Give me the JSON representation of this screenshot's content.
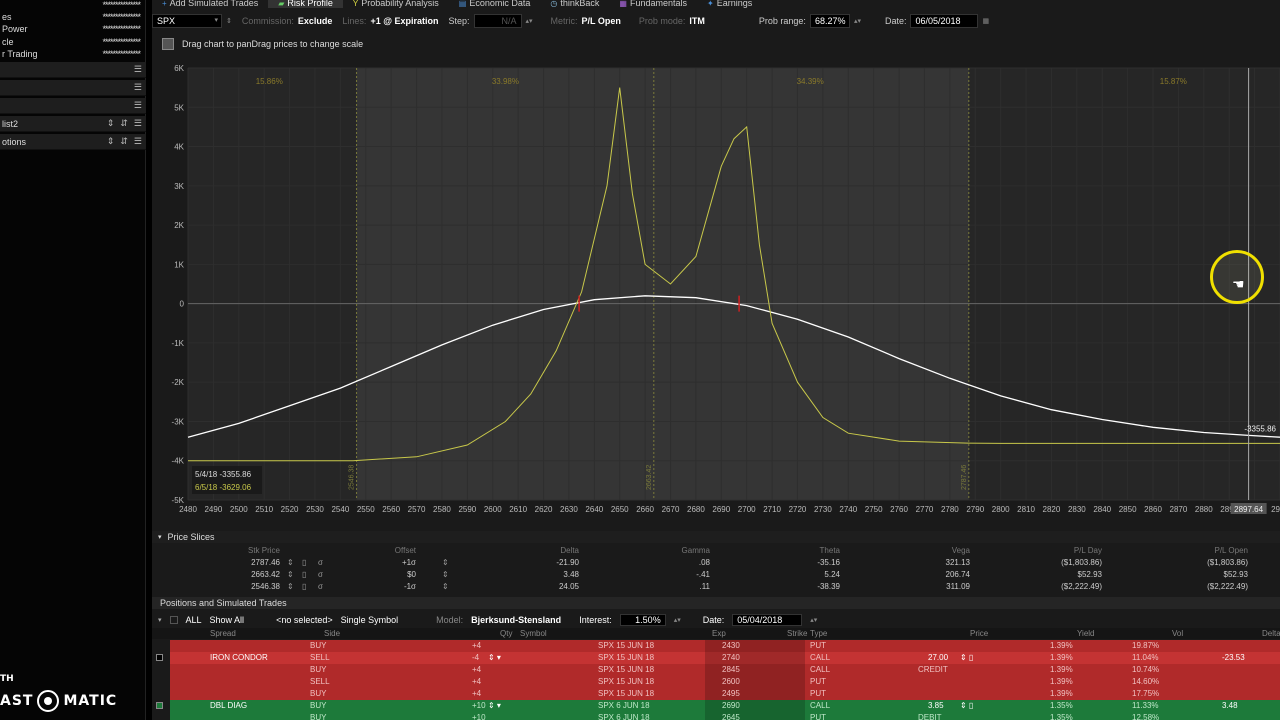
{
  "sidebar": {
    "rows": [
      {
        "label": "",
        "value": "***************"
      },
      {
        "label": "es",
        "value": "***************"
      },
      {
        "label": "Power",
        "value": "***************"
      },
      {
        "label": "cle",
        "value": "***************"
      },
      {
        "label": "r Trading",
        "value": "***************"
      }
    ],
    "panels": [
      {
        "label": ""
      },
      {
        "label": ""
      },
      {
        "label": ""
      },
      {
        "label": ""
      },
      {
        "label": "list2"
      },
      {
        "label": "otions"
      }
    ],
    "watermark_top": "TH",
    "watermark_left": "AST",
    "watermark_right": "MATIC"
  },
  "tabs": [
    {
      "label": "Add Simulated Trades",
      "icon": "plus-icon"
    },
    {
      "label": "Risk Profile",
      "icon": "risk-profile-icon",
      "active": true
    },
    {
      "label": "Probability Analysis",
      "icon": "probability-icon"
    },
    {
      "label": "Economic Data",
      "icon": "economic-data-icon"
    },
    {
      "label": "thinkBack",
      "icon": "thinkback-icon"
    },
    {
      "label": "Fundamentals",
      "icon": "fundamentals-icon"
    },
    {
      "label": "Earnings",
      "icon": "earnings-icon"
    }
  ],
  "controls": {
    "symbol": "SPX",
    "commission_label": "Commission:",
    "commission_value": "Exclude",
    "lines_label": "Lines:",
    "lines_value": "+1 @ Expiration",
    "step_label": "Step:",
    "step_value": "N/A",
    "metric_label": "Metric:",
    "metric_value": "P/L Open",
    "prob_mode_label": "Prob mode:",
    "prob_mode_value": "ITM",
    "prob_range_label": "Prob range:",
    "prob_range_value": "68.27%",
    "date_label": "Date:",
    "date_value": "06/05/2018"
  },
  "chart_toolbar": {
    "hint": "Drag chart to panDrag prices to change scale"
  },
  "chart_data": {
    "type": "line",
    "xlim": [
      2480,
      2910
    ],
    "ylim": [
      -5000,
      6000
    ],
    "x_ticks": [
      2480,
      2490,
      2500,
      2510,
      2520,
      2530,
      2540,
      2550,
      2560,
      2570,
      2580,
      2590,
      2600,
      2610,
      2620,
      2630,
      2640,
      2650,
      2660,
      2670,
      2680,
      2690,
      2700,
      2710,
      2720,
      2730,
      2740,
      2750,
      2760,
      2770,
      2780,
      2790,
      2800,
      2810,
      2820,
      2830,
      2840,
      2850,
      2860,
      2870,
      2880,
      2890,
      2900,
      2910
    ],
    "y_ticks": [
      {
        "v": 6000,
        "label": "6K"
      },
      {
        "v": 5000,
        "label": "5K"
      },
      {
        "v": 4000,
        "label": "4K"
      },
      {
        "v": 3000,
        "label": "3K"
      },
      {
        "v": 2000,
        "label": "2K"
      },
      {
        "v": 1000,
        "label": "1K"
      },
      {
        "v": 0,
        "label": "0"
      },
      {
        "v": -1000,
        "label": "-1K"
      },
      {
        "v": -2000,
        "label": "-2K"
      },
      {
        "v": -3000,
        "label": "-3K"
      },
      {
        "v": -4000,
        "label": "-4K"
      },
      {
        "v": -5000,
        "label": "-5K"
      }
    ],
    "shaded_range": [
      2546.38,
      2787.46
    ],
    "center_price": 2663.42,
    "prob_labels": [
      {
        "x": 2512,
        "text": "15.86%"
      },
      {
        "x": 2605,
        "text": "33.98%"
      },
      {
        "x": 2725,
        "text": "34.39%"
      },
      {
        "x": 2868,
        "text": "15.87%"
      }
    ],
    "vline_labels": [
      {
        "x": 2546.38,
        "text": "2546.38"
      },
      {
        "x": 2663.42,
        "text": "2663.42"
      },
      {
        "x": 2787.46,
        "text": "2787.46"
      }
    ],
    "cursor_x_label": "2897.64",
    "cursor_y_label": "-3355.86",
    "legend": [
      {
        "text": "5/4/18  -3355.86",
        "color": "#dddddd"
      },
      {
        "text": "6/5/18  -3629.06",
        "color": "#c8c84a"
      }
    ],
    "series": [
      {
        "name": "5/4/18",
        "color": "#ffffff",
        "x": [
          2480,
          2500,
          2520,
          2540,
          2560,
          2580,
          2600,
          2620,
          2640,
          2660,
          2680,
          2700,
          2720,
          2740,
          2760,
          2780,
          2800,
          2820,
          2840,
          2860,
          2880,
          2897.64,
          2910
        ],
        "y": [
          -3400,
          -3050,
          -2600,
          -2150,
          -1600,
          -1050,
          -550,
          -150,
          100,
          200,
          150,
          -50,
          -400,
          -850,
          -1400,
          -1900,
          -2350,
          -2700,
          -2950,
          -3150,
          -3280,
          -3355.86,
          -3400
        ]
      },
      {
        "name": "6/5/18",
        "color": "#c8c84a",
        "x": [
          2480,
          2545,
          2570,
          2590,
          2605,
          2615,
          2625,
          2635,
          2645,
          2650,
          2655,
          2660,
          2670,
          2680,
          2690,
          2695,
          2700,
          2705,
          2710,
          2720,
          2730,
          2740,
          2760,
          2787,
          2800,
          2910
        ],
        "y": [
          -4000,
          -4000,
          -3900,
          -3600,
          -3000,
          -2300,
          -1200,
          300,
          3000,
          5500,
          2800,
          1000,
          500,
          1200,
          3500,
          4200,
          4500,
          1500,
          -500,
          -2000,
          -2900,
          -3300,
          -3500,
          -3550,
          -3560,
          -3560
        ]
      }
    ],
    "red_markers": [
      2634,
      2697
    ]
  },
  "slices": {
    "title": "Price Slices",
    "headers": [
      "Stk Price",
      "Offset",
      "Delta",
      "Gamma",
      "Theta",
      "Vega",
      "P/L Day",
      "P/L Open"
    ],
    "rows": [
      [
        "2787.46",
        "+1σ",
        "-21.90",
        ".08",
        "-35.16",
        "321.13",
        "($1,803.86)",
        "($1,803.86)"
      ],
      [
        "2663.42",
        "$0",
        "3.48",
        "-.41",
        "5.24",
        "206.74",
        "$52.93",
        "$52.93"
      ],
      [
        "2546.38",
        "-1σ",
        "24.05",
        ".11",
        "-38.39",
        "311.09",
        "($2,222.49)",
        "($2,222.49)"
      ]
    ]
  },
  "positions": {
    "title": "Positions and Simulated Trades",
    "all_label": "ALL",
    "show_all": "Show All",
    "selected": "<no selected>",
    "single_symbol": "Single Symbol",
    "model_label": "Model:",
    "model_value": "Bjerksund-Stensland",
    "interest_label": "Interest:",
    "interest_value": "1.50%",
    "date_label": "Date:",
    "date_value": "05/04/2018",
    "headers": [
      "Spread",
      "Side",
      "Qty",
      "Symbol",
      "Exp",
      "Strike",
      "Type",
      "Price",
      "Yield",
      "Vol",
      "Delta"
    ],
    "rows": [
      {
        "style": "red",
        "spread": "",
        "side": "BUY",
        "qty": "+4",
        "symbol": "SPX 15 JUN 18",
        "strike": "2430",
        "type": "PUT",
        "price": "",
        "price2": "",
        "yield": "1.39%",
        "vol": "19.87%",
        "delta": ""
      },
      {
        "style": "red2",
        "spread": "IRON CONDOR",
        "side": "SELL",
        "qty": "-4",
        "symbol": "SPX 15 JUN 18",
        "strike": "2740",
        "type": "CALL",
        "price": "27.00",
        "price2": "",
        "yield": "1.39%",
        "vol": "11.04%",
        "delta": "-23.53"
      },
      {
        "style": "red",
        "spread": "",
        "side": "BUY",
        "qty": "+4",
        "symbol": "SPX 15 JUN 18",
        "strike": "2845",
        "type": "CALL",
        "price": "",
        "price2": "CREDIT",
        "yield": "1.39%",
        "vol": "10.74%",
        "delta": ""
      },
      {
        "style": "red",
        "spread": "",
        "side": "SELL",
        "qty": "+4",
        "symbol": "SPX 15 JUN 18",
        "strike": "2600",
        "type": "PUT",
        "price": "",
        "price2": "",
        "yield": "1.39%",
        "vol": "14.60%",
        "delta": ""
      },
      {
        "style": "red",
        "spread": "",
        "side": "BUY",
        "qty": "+4",
        "symbol": "SPX 15 JUN 18",
        "strike": "2495",
        "type": "PUT",
        "price": "",
        "price2": "",
        "yield": "1.39%",
        "vol": "17.75%",
        "delta": ""
      },
      {
        "style": "green",
        "spread": "DBL DIAG",
        "side": "BUY",
        "qty": "+10",
        "symbol": "SPX 6 JUN 18",
        "strike": "2690",
        "type": "CALL",
        "price": "3.85",
        "price2": "",
        "yield": "1.35%",
        "vol": "11.33%",
        "delta": "3.48"
      },
      {
        "style": "green",
        "spread": "",
        "side": "BUY",
        "qty": "+10",
        "symbol": "SPX 6 JUN 18",
        "strike": "2645",
        "type": "PUT",
        "price": "",
        "price2": "DEBIT",
        "yield": "1.35%",
        "vol": "12.58%",
        "delta": ""
      }
    ]
  }
}
